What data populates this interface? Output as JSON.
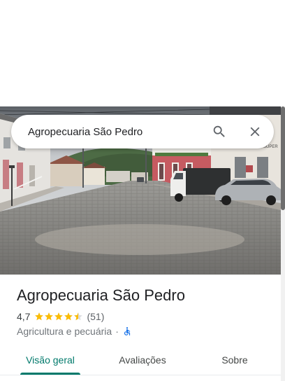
{
  "search": {
    "value": "Agropecuaria São Pedro",
    "icons": {
      "search": "search-icon",
      "clear": "close-icon"
    }
  },
  "photo": {
    "sign_text": "SUPER"
  },
  "place": {
    "name": "Agropecuaria São Pedro",
    "rating": "4,7",
    "rating_value": 4.7,
    "stars_max": 5,
    "review_count": "(51)",
    "category": "Agricultura e pecuária",
    "separator": "·",
    "accessibility_icon": "wheelchair-icon"
  },
  "tabs": [
    {
      "label": "Visão geral",
      "active": true
    },
    {
      "label": "Avaliações",
      "active": false
    },
    {
      "label": "Sobre",
      "active": false
    }
  ],
  "colors": {
    "accent": "#00796b",
    "star_filled": "#fbbc04",
    "star_empty": "#dadce0",
    "accessibility_icon": "#1a73e8"
  }
}
